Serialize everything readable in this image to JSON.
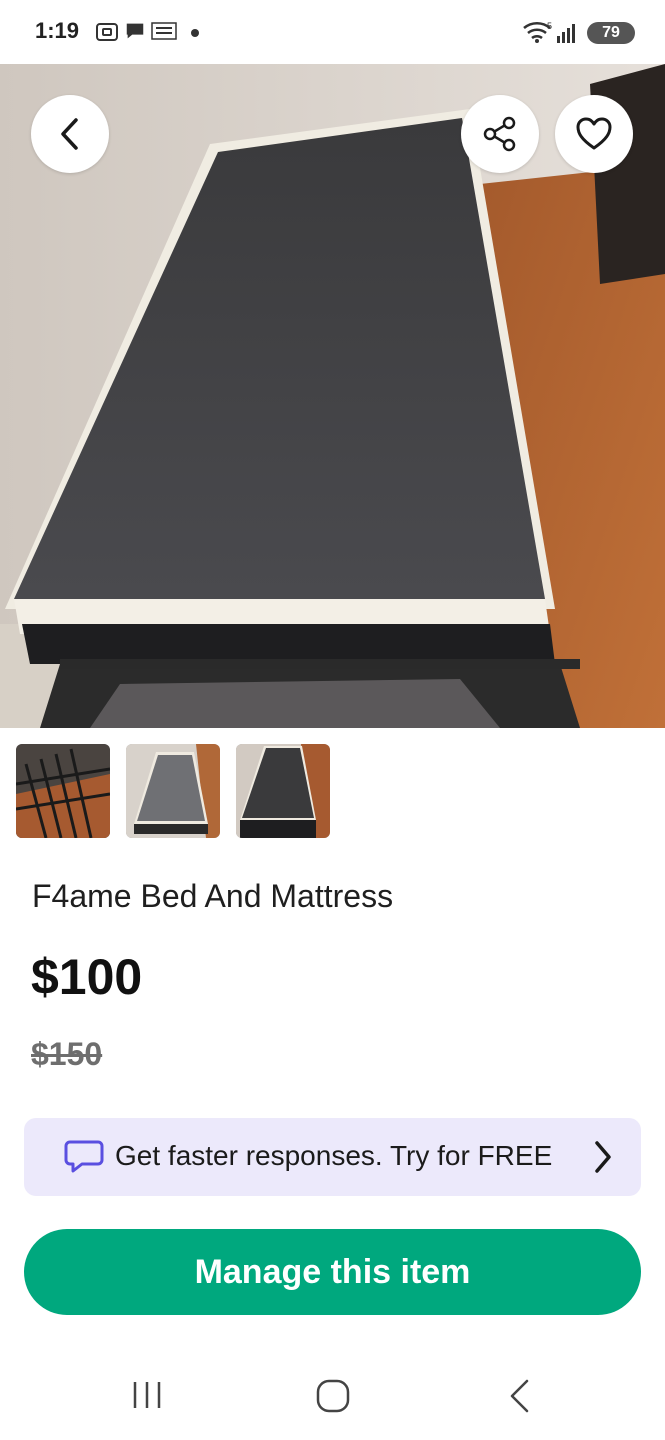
{
  "status_bar": {
    "time": "1:19",
    "battery": "79",
    "icons": [
      "screenshot-icon",
      "chat-icon",
      "temu-icon",
      "dot-icon",
      "wifi-icon",
      "signal-icon"
    ]
  },
  "product": {
    "title": "F4ame Bed And Mattress",
    "price": "$100",
    "original_price": "$150",
    "image_count": 3
  },
  "actions": {
    "back": "back-icon",
    "share": "share-icon",
    "favorite": "heart-icon"
  },
  "promo": {
    "text": "Get faster responses. Try for FREE"
  },
  "manage_button": {
    "label": "Manage this item"
  },
  "colors": {
    "accent": "#00a87e",
    "promo_bg": "#ece9fb",
    "promo_icon": "#5a4fe0"
  }
}
